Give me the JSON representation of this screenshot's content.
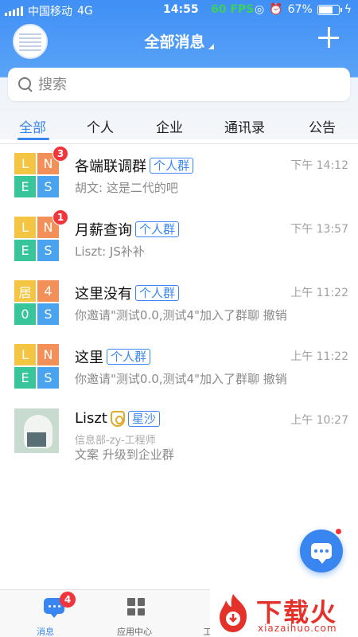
{
  "status_bar": {
    "carrier": "中国移动",
    "network": "4G",
    "time": "14:55",
    "fps": "60 FPS",
    "battery": "67%",
    "battery_fraction": 0.67
  },
  "header": {
    "title": "全部消息",
    "accent_color": "#3a86f0"
  },
  "search": {
    "placeholder": "搜索"
  },
  "tabs": [
    {
      "label": "全部",
      "active": true
    },
    {
      "label": "个人",
      "active": false
    },
    {
      "label": "企业",
      "active": false
    },
    {
      "label": "通讯录",
      "active": false
    },
    {
      "label": "公告",
      "active": false
    }
  ],
  "conversations": [
    {
      "name": "各端联调群",
      "tag": "个人群",
      "time": "下午 14:12",
      "preview": "胡文: 这是二代的吧",
      "badge": "3",
      "avatar_cells": [
        {
          "text": "L",
          "color": "#f4c542"
        },
        {
          "text": "N",
          "color": "#f3905a"
        },
        {
          "text": "E",
          "color": "#38c59b"
        },
        {
          "text": "S",
          "color": "#4aa3ef"
        }
      ]
    },
    {
      "name": "月薪查询",
      "tag": "个人群",
      "time": "下午 13:57",
      "preview": "Liszt: JS补补",
      "badge": "1",
      "avatar_cells": [
        {
          "text": "L",
          "color": "#f4c542"
        },
        {
          "text": "N",
          "color": "#f3905a"
        },
        {
          "text": "E",
          "color": "#38c59b"
        },
        {
          "text": "S",
          "color": "#4aa3ef"
        }
      ]
    },
    {
      "name": "这里没有",
      "tag": "个人群",
      "time": "上午 11:22",
      "preview": "你邀请\"测试0.0,测试4\"加入了群聊 撤销",
      "badge": "",
      "avatar_cells": [
        {
          "text": "居",
          "color": "#f4c542"
        },
        {
          "text": "4",
          "color": "#f3905a"
        },
        {
          "text": "0",
          "color": "#38c59b"
        },
        {
          "text": "S",
          "color": "#4aa3ef"
        }
      ]
    },
    {
      "name": "这里",
      "tag": "个人群",
      "time": "上午 11:22",
      "preview": "你邀请\"测试0.0,测试4\"加入了群聊 撤销",
      "badge": "",
      "avatar_cells": [
        {
          "text": "L",
          "color": "#f4c542"
        },
        {
          "text": "N",
          "color": "#f3905a"
        },
        {
          "text": "E",
          "color": "#38c59b"
        },
        {
          "text": "S",
          "color": "#4aa3ef"
        }
      ]
    }
  ],
  "contact_row": {
    "name": "Liszt",
    "tag": "星沙",
    "time": "上午 10:27",
    "subtitle": "信息部-zy-工程师",
    "preview": "文案  升级到企业群",
    "avatar_icon": "polar-bear-reading-photo"
  },
  "bottom_nav": [
    {
      "label": "消息",
      "badge": "4",
      "icon": "chat-icon",
      "active": true
    },
    {
      "label": "应用中心",
      "badge": "",
      "icon": "apps-grid-icon",
      "active": false
    },
    {
      "label": "工",
      "badge": "",
      "icon": "",
      "active": false
    }
  ],
  "watermark": {
    "text": "下载火",
    "url": "xiazaihuo.com",
    "color": "#e4322a"
  }
}
